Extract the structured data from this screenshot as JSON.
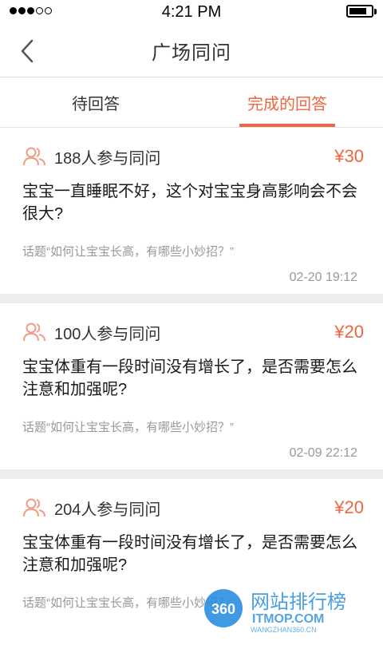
{
  "status_bar": {
    "time": "4:21 PM",
    "signal_filled": 3,
    "signal_total": 5,
    "battery_level": 0.8
  },
  "nav": {
    "title": "广场同问"
  },
  "tabs": [
    {
      "label": "待回答",
      "active": false
    },
    {
      "label": "完成的回答",
      "active": true
    }
  ],
  "cards": [
    {
      "participants": "188人参与同问",
      "reward": "¥30",
      "question": "宝宝一直睡眠不好，这个对宝宝身高影响会不会很大?",
      "topic": "话题“如何让宝宝长高，有哪些小妙招？”",
      "time": "02-20 19:12"
    },
    {
      "participants": "100人参与同问",
      "reward": "¥20",
      "question": "宝宝体重有一段时间没有增长了，是否需要怎么注意和加强呢?",
      "topic": "话题“如何让宝宝长高，有哪些小妙招？”",
      "time": "02-09 22:12"
    },
    {
      "participants": "204人参与同问",
      "reward": "¥20",
      "question": "宝宝体重有一段时间没有增长了，是否需要怎么注意和加强呢?",
      "topic": "话题“如何让宝宝长高，有哪些小妙招？”",
      "time": ""
    }
  ],
  "watermark": {
    "badge": "360",
    "title": "网站排行榜",
    "url": "ITMOP.COM",
    "sub": "WANGZHAN360.CN"
  },
  "colors": {
    "accent": "#f0653f",
    "icon_stroke": "#f29b86"
  },
  "icons": {
    "back": "chevron-left-icon",
    "participants": "people-icon"
  }
}
